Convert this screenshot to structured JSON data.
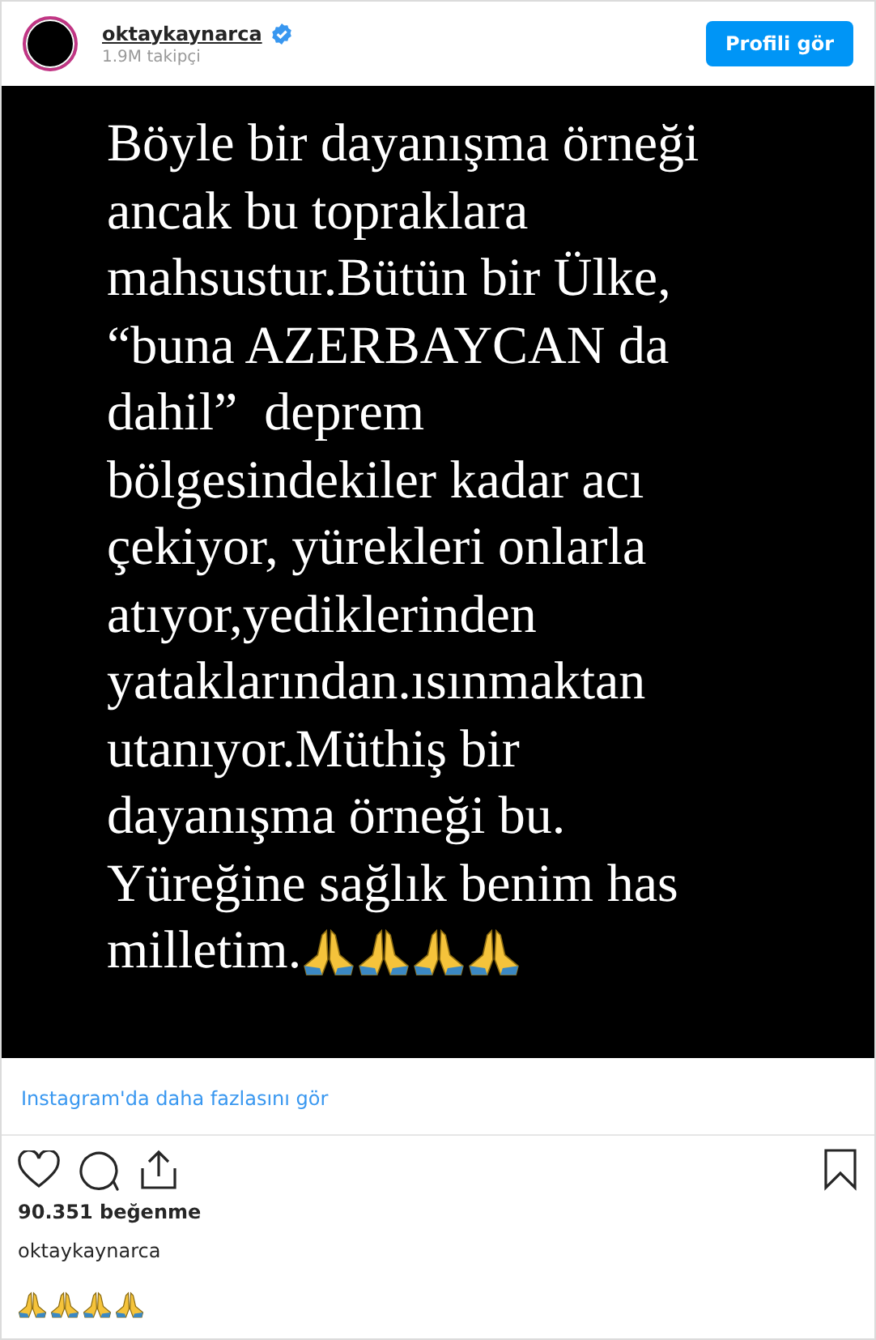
{
  "header": {
    "username": "oktaykaynarca",
    "verified": true,
    "followers": "1.9M takipçi",
    "button": "Profili gör"
  },
  "post_image": {
    "lines": [
      "Böyle bir dayanışma örneği",
      "ancak bu topraklara",
      "mahsustur.Bütün bir Ülke,",
      "“buna AZERBAYCAN da",
      "dahil”  deprem",
      "bölgesindekiler kadar acı",
      "çekiyor, yürekleri onlarla",
      "atıyor,yediklerinden",
      "yataklarından.ısınmaktan",
      "utanıyor.Müthiş bir",
      "dayanışma örneği bu.",
      "Yüreğine sağlık benim has",
      "milletim."
    ]
  },
  "more_link": "Instagram'da daha fazlasını gör",
  "likes": "90.351 beğenme",
  "caption_user": "oktaykaynarca"
}
